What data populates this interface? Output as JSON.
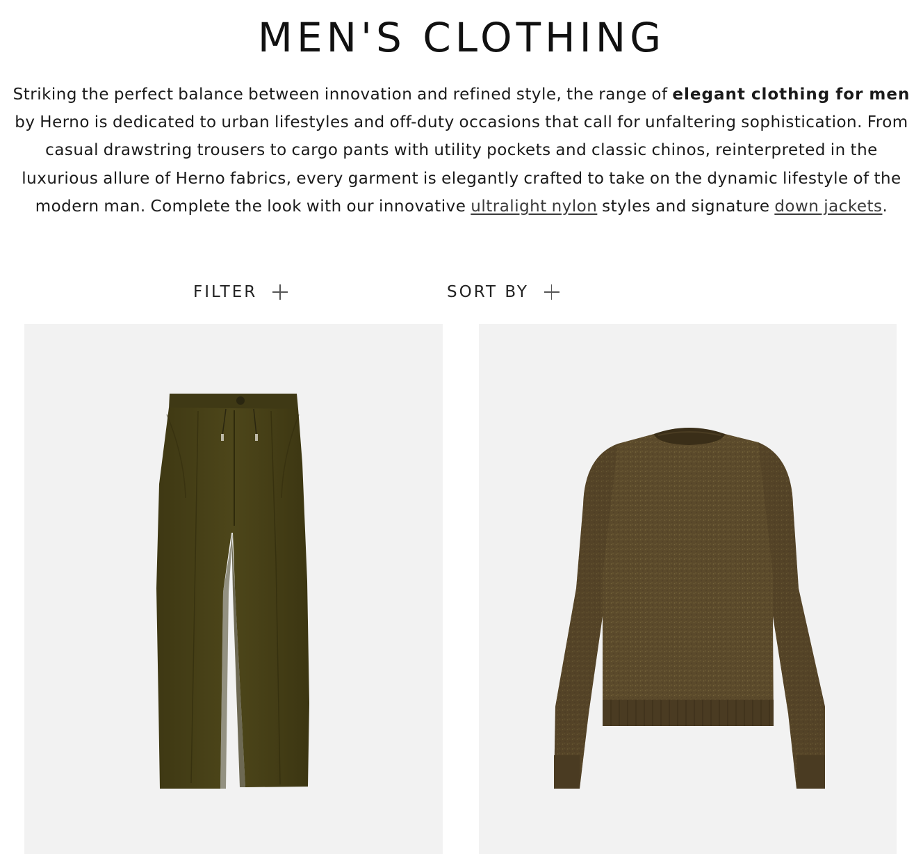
{
  "page": {
    "title": "MEN'S CLOTHING"
  },
  "intro": {
    "text_1": "Striking the perfect balance between innovation and refined style, the range of ",
    "bold": "elegant clothing for men",
    "text_2": " by Herno is dedicated to urban lifestyles and off-duty occasions that call for unfaltering sophistication. From casual drawstring trousers to cargo pants with utility pockets and classic chinos, reinterpreted in the luxurious allure of Herno fabrics, every garment is elegantly crafted to take on the dynamic lifestyle of the modern man. Complete the look with our innovative ",
    "link_1": "ultralight nylon",
    "text_3": " styles and signature ",
    "link_2": "down jackets",
    "text_4": "."
  },
  "controls": {
    "filter_label": "FILTER",
    "sort_label": "SORT BY"
  },
  "products": [
    {
      "image": "olive-drawstring-trousers",
      "color": "#4a4218"
    },
    {
      "image": "brown-crewneck-sweater",
      "color": "#5a4a2a"
    }
  ],
  "colors": {
    "card_background": "#f2f2f2",
    "text": "#1a1a1a"
  }
}
